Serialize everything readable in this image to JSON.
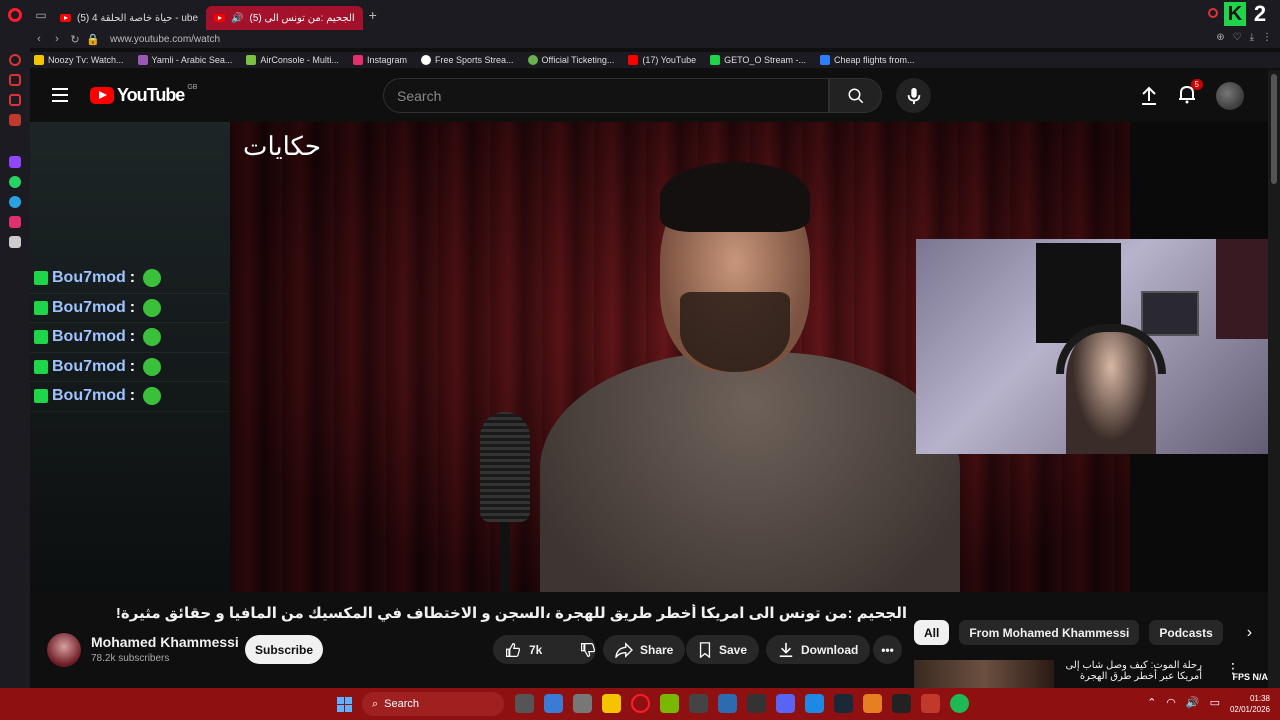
{
  "browser": {
    "tabs": [
      {
        "label": "(5) حياة خاصة الحلقة 4 - ube",
        "active": false
      },
      {
        "label": "(5) الجحيم :من تونس الى",
        "active": true
      }
    ],
    "url": "www.youtube.com/watch",
    "bookmarks": [
      {
        "label": "Noozy Tv: Watch...",
        "color": "#f5c400"
      },
      {
        "label": "Yamli - Arabic Sea...",
        "color": "#9b59b6"
      },
      {
        "label": "AirConsole - Multi...",
        "color": "#7ac143"
      },
      {
        "label": "Instagram",
        "color": "#e1306c"
      },
      {
        "label": "Free Sports Strea...",
        "color": "#ffffff"
      },
      {
        "label": "Official Ticketing...",
        "color": "#6ab04c"
      },
      {
        "label": "(17) YouTube",
        "color": "#ff0000"
      },
      {
        "label": "GETO_O Stream -...",
        "color": "#1fd54a"
      },
      {
        "label": "Cheap flights from...",
        "color": "#2d7ff9"
      }
    ]
  },
  "youtube": {
    "logo_text": "YouTube",
    "country_code": "GB",
    "search_placeholder": "Search",
    "notifications_count": "5"
  },
  "video": {
    "overlay_logo": "حكايات",
    "chat": [
      {
        "user": "Bou7mod",
        "sep": ":"
      },
      {
        "user": "Bou7mod",
        "sep": ":"
      },
      {
        "user": "Bou7mod",
        "sep": ":"
      },
      {
        "user": "Bou7mod",
        "sep": ":"
      },
      {
        "user": "Bou7mod",
        "sep": ":"
      }
    ],
    "title": "الجحيم :من تونس الى امريكا أخطر طريق للهجرة ،السجن و الاختطاف في المكسيك من المافيا و حقائق مثيرة!",
    "channel": {
      "name": "Mohamed Khammessi",
      "subscribers": "78.2k subscribers"
    },
    "actions": {
      "subscribe": "Subscribe",
      "likes": "7k",
      "share": "Share",
      "save": "Save",
      "download": "Download"
    }
  },
  "related": {
    "chips": [
      "All",
      "From Mohamed Khammessi",
      "Podcasts"
    ],
    "first_title": "رحلة الموت: كيف وصل شاب إلى أمريكا عبر أخطر طرق الهجرة"
  },
  "overlay_fps": {
    "label": "FPS",
    "value": "N/A"
  },
  "taskbar": {
    "search_label": "Search",
    "time": "01:38",
    "date": "02/01/2026"
  }
}
